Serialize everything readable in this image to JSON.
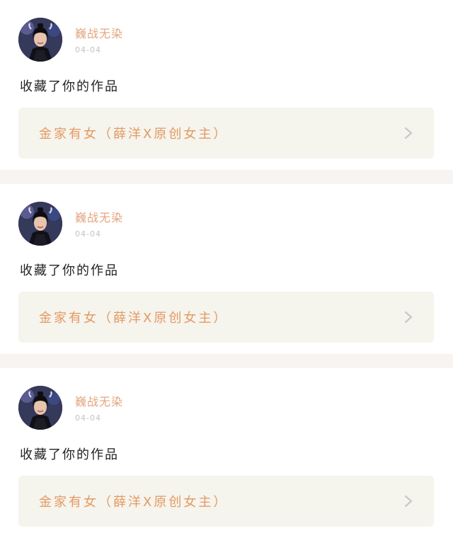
{
  "feed": {
    "items": [
      {
        "user_name": "巍战无染",
        "date": "04-04",
        "action": "收藏了你的作品",
        "work_title": "金家有女（薛洋X原创女主）",
        "avatar_icon": "user-avatar-icon",
        "chevron_icon": "chevron-right-icon"
      },
      {
        "user_name": "巍战无染",
        "date": "04-04",
        "action": "收藏了你的作品",
        "work_title": "金家有女（薛洋X原创女主）",
        "avatar_icon": "user-avatar-icon",
        "chevron_icon": "chevron-right-icon"
      },
      {
        "user_name": "巍战无染",
        "date": "04-04",
        "action": "收藏了你的作品",
        "work_title": "金家有女（薛洋X原创女主）",
        "avatar_icon": "user-avatar-icon",
        "chevron_icon": "chevron-right-icon"
      }
    ]
  },
  "colors": {
    "username": "#e3a57f",
    "date": "#c3c3c3",
    "action_text": "#222222",
    "work_title": "#e59962",
    "work_card_bg": "#f5f4ed",
    "separator": "#f7f4f2",
    "chevron": "#c8c8c8"
  }
}
